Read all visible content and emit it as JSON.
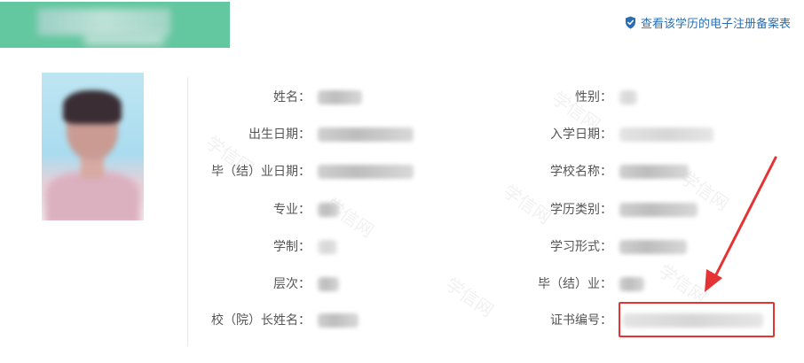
{
  "header": {
    "link_text": "查看该学历的电子注册备案表"
  },
  "watermark": {
    "text": "学信网"
  },
  "fields": {
    "name_label": "姓名：",
    "birthdate_label": "出生日期：",
    "graduation_date_label": "毕（结）业日期：",
    "major_label": "专业：",
    "duration_label": "学制：",
    "level_label": "层次：",
    "president_label": "校（院）长姓名：",
    "gender_label": "性别：",
    "enroll_date_label": "入学日期：",
    "school_name_label": "学校名称：",
    "degree_type_label": "学历类别：",
    "study_form_label": "学习形式：",
    "graduation_status_label": "毕（结）业：",
    "certificate_no_label": "证书编号："
  },
  "colors": {
    "banner_green": "#63c79f",
    "link_blue": "#2b6db3",
    "highlight_red": "#e53333"
  },
  "icons": {
    "link_icon": "shield-check-icon"
  }
}
